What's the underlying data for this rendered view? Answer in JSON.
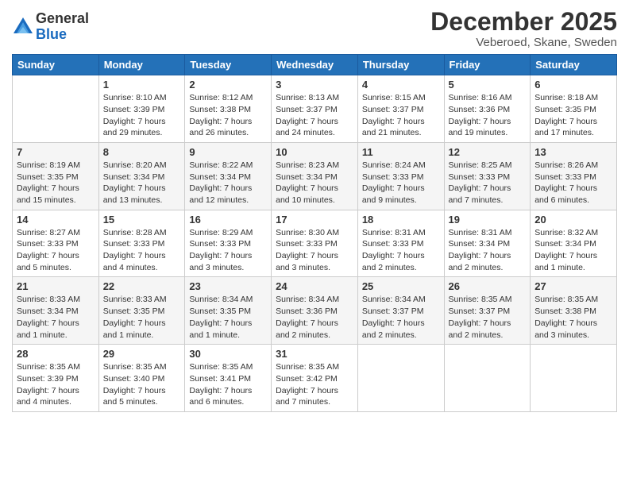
{
  "logo": {
    "general": "General",
    "blue": "Blue"
  },
  "header": {
    "title": "December 2025",
    "subtitle": "Veberoed, Skane, Sweden"
  },
  "days_of_week": [
    "Sunday",
    "Monday",
    "Tuesday",
    "Wednesday",
    "Thursday",
    "Friday",
    "Saturday"
  ],
  "weeks": [
    [
      {
        "day": "",
        "info": ""
      },
      {
        "day": "1",
        "info": "Sunrise: 8:10 AM\nSunset: 3:39 PM\nDaylight: 7 hours\nand 29 minutes."
      },
      {
        "day": "2",
        "info": "Sunrise: 8:12 AM\nSunset: 3:38 PM\nDaylight: 7 hours\nand 26 minutes."
      },
      {
        "day": "3",
        "info": "Sunrise: 8:13 AM\nSunset: 3:37 PM\nDaylight: 7 hours\nand 24 minutes."
      },
      {
        "day": "4",
        "info": "Sunrise: 8:15 AM\nSunset: 3:37 PM\nDaylight: 7 hours\nand 21 minutes."
      },
      {
        "day": "5",
        "info": "Sunrise: 8:16 AM\nSunset: 3:36 PM\nDaylight: 7 hours\nand 19 minutes."
      },
      {
        "day": "6",
        "info": "Sunrise: 8:18 AM\nSunset: 3:35 PM\nDaylight: 7 hours\nand 17 minutes."
      }
    ],
    [
      {
        "day": "7",
        "info": "Sunrise: 8:19 AM\nSunset: 3:35 PM\nDaylight: 7 hours\nand 15 minutes."
      },
      {
        "day": "8",
        "info": "Sunrise: 8:20 AM\nSunset: 3:34 PM\nDaylight: 7 hours\nand 13 minutes."
      },
      {
        "day": "9",
        "info": "Sunrise: 8:22 AM\nSunset: 3:34 PM\nDaylight: 7 hours\nand 12 minutes."
      },
      {
        "day": "10",
        "info": "Sunrise: 8:23 AM\nSunset: 3:34 PM\nDaylight: 7 hours\nand 10 minutes."
      },
      {
        "day": "11",
        "info": "Sunrise: 8:24 AM\nSunset: 3:33 PM\nDaylight: 7 hours\nand 9 minutes."
      },
      {
        "day": "12",
        "info": "Sunrise: 8:25 AM\nSunset: 3:33 PM\nDaylight: 7 hours\nand 7 minutes."
      },
      {
        "day": "13",
        "info": "Sunrise: 8:26 AM\nSunset: 3:33 PM\nDaylight: 7 hours\nand 6 minutes."
      }
    ],
    [
      {
        "day": "14",
        "info": "Sunrise: 8:27 AM\nSunset: 3:33 PM\nDaylight: 7 hours\nand 5 minutes."
      },
      {
        "day": "15",
        "info": "Sunrise: 8:28 AM\nSunset: 3:33 PM\nDaylight: 7 hours\nand 4 minutes."
      },
      {
        "day": "16",
        "info": "Sunrise: 8:29 AM\nSunset: 3:33 PM\nDaylight: 7 hours\nand 3 minutes."
      },
      {
        "day": "17",
        "info": "Sunrise: 8:30 AM\nSunset: 3:33 PM\nDaylight: 7 hours\nand 3 minutes."
      },
      {
        "day": "18",
        "info": "Sunrise: 8:31 AM\nSunset: 3:33 PM\nDaylight: 7 hours\nand 2 minutes."
      },
      {
        "day": "19",
        "info": "Sunrise: 8:31 AM\nSunset: 3:34 PM\nDaylight: 7 hours\nand 2 minutes."
      },
      {
        "day": "20",
        "info": "Sunrise: 8:32 AM\nSunset: 3:34 PM\nDaylight: 7 hours\nand 1 minute."
      }
    ],
    [
      {
        "day": "21",
        "info": "Sunrise: 8:33 AM\nSunset: 3:34 PM\nDaylight: 7 hours\nand 1 minute."
      },
      {
        "day": "22",
        "info": "Sunrise: 8:33 AM\nSunset: 3:35 PM\nDaylight: 7 hours\nand 1 minute."
      },
      {
        "day": "23",
        "info": "Sunrise: 8:34 AM\nSunset: 3:35 PM\nDaylight: 7 hours\nand 1 minute."
      },
      {
        "day": "24",
        "info": "Sunrise: 8:34 AM\nSunset: 3:36 PM\nDaylight: 7 hours\nand 2 minutes."
      },
      {
        "day": "25",
        "info": "Sunrise: 8:34 AM\nSunset: 3:37 PM\nDaylight: 7 hours\nand 2 minutes."
      },
      {
        "day": "26",
        "info": "Sunrise: 8:35 AM\nSunset: 3:37 PM\nDaylight: 7 hours\nand 2 minutes."
      },
      {
        "day": "27",
        "info": "Sunrise: 8:35 AM\nSunset: 3:38 PM\nDaylight: 7 hours\nand 3 minutes."
      }
    ],
    [
      {
        "day": "28",
        "info": "Sunrise: 8:35 AM\nSunset: 3:39 PM\nDaylight: 7 hours\nand 4 minutes."
      },
      {
        "day": "29",
        "info": "Sunrise: 8:35 AM\nSunset: 3:40 PM\nDaylight: 7 hours\nand 5 minutes."
      },
      {
        "day": "30",
        "info": "Sunrise: 8:35 AM\nSunset: 3:41 PM\nDaylight: 7 hours\nand 6 minutes."
      },
      {
        "day": "31",
        "info": "Sunrise: 8:35 AM\nSunset: 3:42 PM\nDaylight: 7 hours\nand 7 minutes."
      },
      {
        "day": "",
        "info": ""
      },
      {
        "day": "",
        "info": ""
      },
      {
        "day": "",
        "info": ""
      }
    ]
  ]
}
